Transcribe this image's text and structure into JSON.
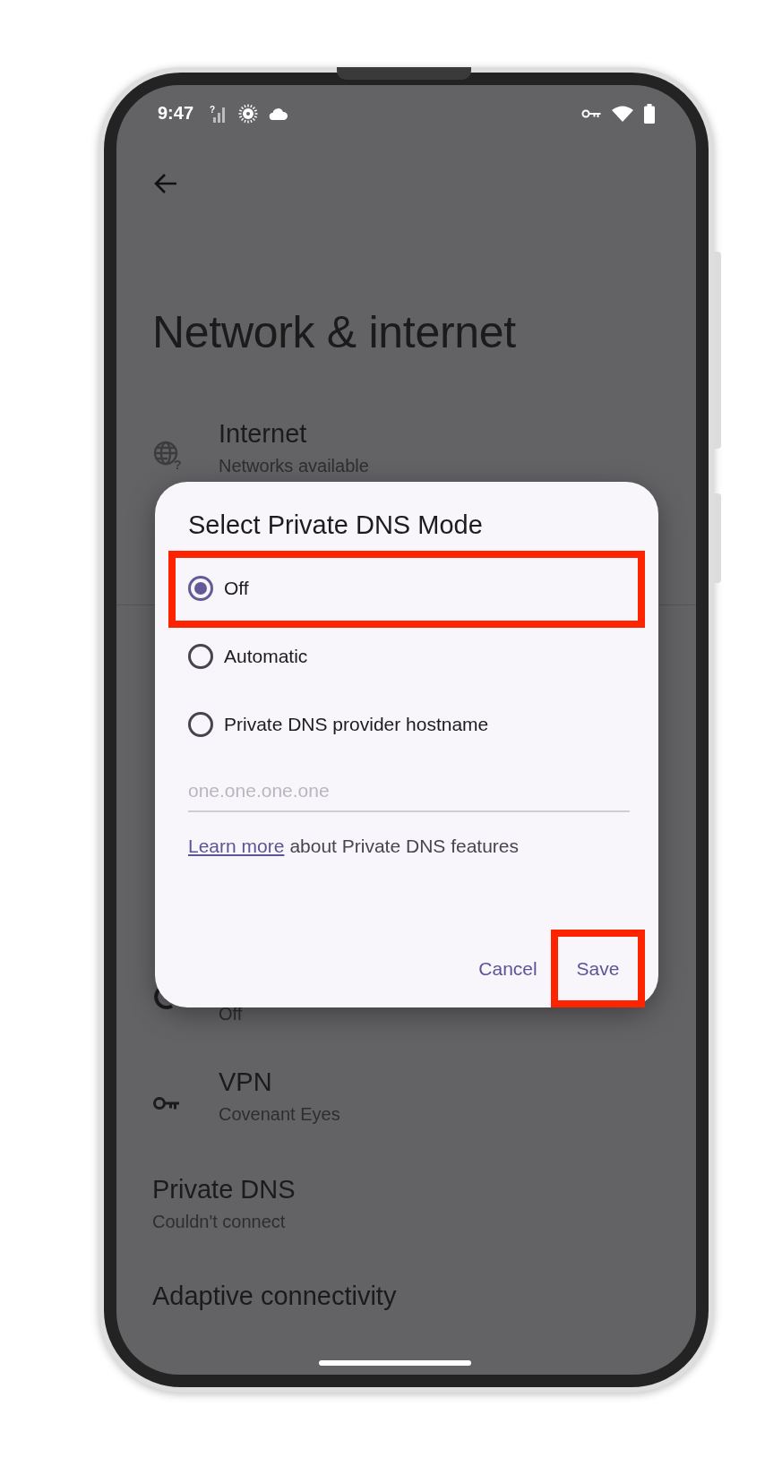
{
  "status_bar": {
    "time": "9:47",
    "signal_badge": "?"
  },
  "page": {
    "title": "Network & internet"
  },
  "settings": [
    {
      "kind": "icon",
      "title": "Internet",
      "subtitle": "Networks available",
      "icon_badge": "?"
    },
    {
      "kind": "covered",
      "subtitle": "Off"
    },
    {
      "kind": "icon",
      "title": "VPN",
      "subtitle": "Covenant Eyes"
    },
    {
      "kind": "plain",
      "title": "Private DNS",
      "subtitle": "Couldn't connect"
    },
    {
      "kind": "plain",
      "title": "Adaptive connectivity"
    }
  ],
  "dialog": {
    "title": "Select Private DNS Mode",
    "options": [
      {
        "label": "Off",
        "selected": true,
        "highlighted": true
      },
      {
        "label": "Automatic",
        "selected": false,
        "highlighted": false
      },
      {
        "label": "Private DNS provider hostname",
        "selected": false,
        "highlighted": false
      }
    ],
    "hostname": {
      "placeholder": "one.one.one.one"
    },
    "note": {
      "link": "Learn more",
      "text": "about Private DNS features"
    },
    "buttons": [
      {
        "label": "Cancel",
        "highlighted": false
      },
      {
        "label": "Save",
        "highlighted": true
      }
    ]
  }
}
